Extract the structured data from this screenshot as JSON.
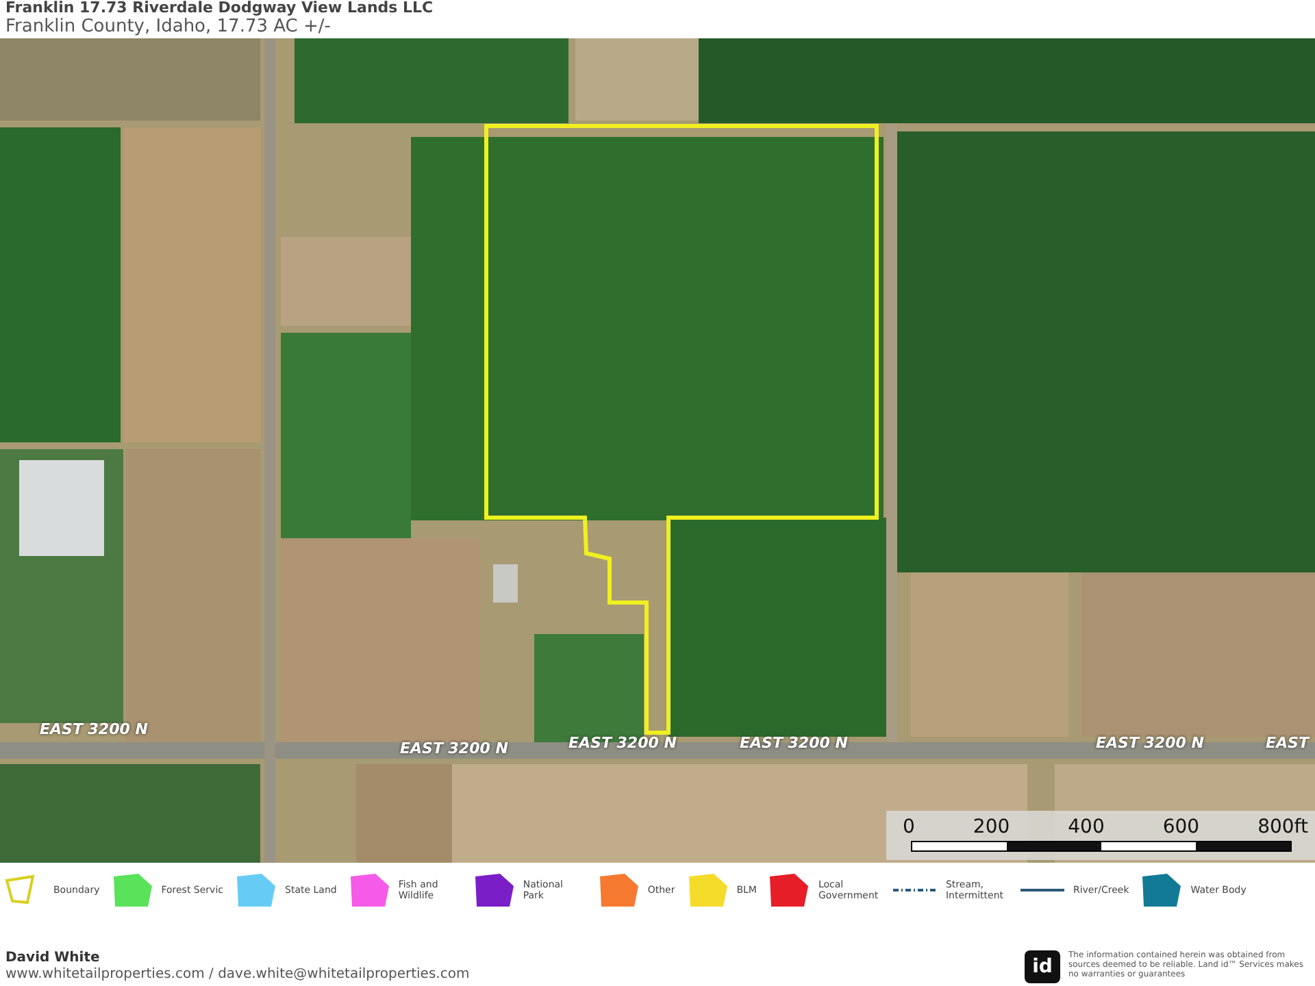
{
  "header": {
    "title": "Franklin 17.73 Riverdale Dodgway View Lands LLC",
    "subtitle": "Franklin County, Idaho, 17.73 AC +/-"
  },
  "map": {
    "road_labels": [
      "EAST 3200 N",
      "EAST 3200 N",
      "EAST 3200 N",
      "EAST 3200 N",
      "EAST 3200 N",
      "EAST"
    ],
    "scale_bar": {
      "labels": [
        "0",
        "200",
        "400",
        "600",
        "800ft"
      ]
    }
  },
  "legend": [
    {
      "label": "Boundary",
      "kind": "outline",
      "color": "#d8d020"
    },
    {
      "label": "Forest Servic",
      "kind": "polygon",
      "color": "#5ae25a"
    },
    {
      "label": "State Land",
      "kind": "polygon",
      "color": "#66ccf5"
    },
    {
      "label": "Fish and Wildlife",
      "kind": "polygon",
      "color": "#f55ae8"
    },
    {
      "label": "National Park",
      "kind": "polygon",
      "color": "#7a1ec8"
    },
    {
      "label": "Other",
      "kind": "polygon",
      "color": "#f57a30"
    },
    {
      "label": "BLM",
      "kind": "polygon",
      "color": "#f5dc2a"
    },
    {
      "label": "Local Government",
      "kind": "polygon",
      "color": "#e61e28"
    },
    {
      "label": "Stream, Intermittent",
      "kind": "dashed",
      "color": "#2a5a7a"
    },
    {
      "label": "River/Creek",
      "kind": "line",
      "color": "#2a5a7a"
    },
    {
      "label": "Water Body",
      "kind": "polygon",
      "color": "#137a96"
    }
  ],
  "footer": {
    "name": "David White",
    "contact": "www.whitetailproperties.com / dave.white@whitetailproperties.com",
    "logo": "id",
    "disclaimer": "The information contained herein was obtained from sources deemed to be reliable. Land id™ Services makes no warranties or guarantees"
  }
}
